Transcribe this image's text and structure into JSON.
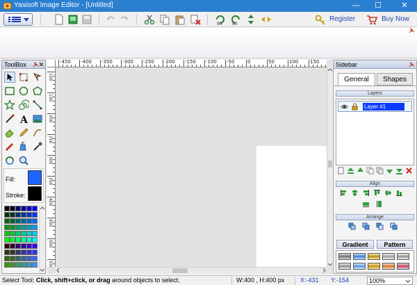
{
  "window": {
    "title": "Yasisoft Image Editor - [Untitled]",
    "minimize": "—",
    "maximize": "☐",
    "close": "✕"
  },
  "toolbar": {
    "register_label": "Register",
    "buy_label": "Buy Now",
    "rotate_left_label": "90",
    "rotate_right_label": "90"
  },
  "toolbox": {
    "title": "ToolBox",
    "fill_label": "Fill:",
    "stroke_label": "Stroke:",
    "fill_color": "#1a66ff",
    "stroke_color": "#000000",
    "palette": [
      [
        "#000000",
        "#000033",
        "#000066",
        "#000099",
        "#0000cc",
        "#0000ff"
      ],
      [
        "#003300",
        "#003333",
        "#003366",
        "#003399",
        "#0033cc",
        "#0033ff"
      ],
      [
        "#006600",
        "#006633",
        "#006666",
        "#006699",
        "#0066cc",
        "#0066ff"
      ],
      [
        "#009900",
        "#009933",
        "#009966",
        "#009999",
        "#0099cc",
        "#0099ff"
      ],
      [
        "#00cc00",
        "#00cc33",
        "#00cc66",
        "#00cc99",
        "#00cccc",
        "#00ccff"
      ],
      [
        "#00ff00",
        "#00ff33",
        "#00ff66",
        "#00ff99",
        "#00ffcc",
        "#00ffff"
      ],
      [
        "#330000",
        "#330033",
        "#330066",
        "#330099",
        "#3300cc",
        "#3300ff"
      ],
      [
        "#333300",
        "#333333",
        "#333366",
        "#333399",
        "#3333cc",
        "#3333ff"
      ],
      [
        "#336600",
        "#336633",
        "#336666",
        "#336699",
        "#3366cc",
        "#3366ff"
      ],
      [
        "#339900",
        "#339933",
        "#339966",
        "#339999",
        "#3399cc",
        "#3399ff"
      ]
    ]
  },
  "ruler": {
    "h_labels": [
      "-450",
      "-400",
      "-350",
      "-300",
      "-250",
      "-200",
      "-150",
      "-100",
      "-50",
      "0",
      "50",
      "100",
      "150"
    ],
    "v_labels": [
      "100",
      "150",
      "200",
      "250",
      "300",
      "350",
      "400",
      "450",
      "500",
      "550"
    ]
  },
  "sidebar": {
    "title": "Sidebar",
    "tabs": [
      "General",
      "Shapes"
    ],
    "layers_header": "Layers",
    "layer_name": "Layer #1",
    "align_header": "Align",
    "arrange_header": "Arrange",
    "bottom_tabs": [
      "Gradient",
      "Pattern"
    ]
  },
  "status": {
    "hint_prefix": "Select Tool: ",
    "hint_bold": "Click, shift+click, or drag",
    "hint_suffix": " around objects to select.",
    "size": "W:400 , H:400 px",
    "x": "X:-431",
    "y": "Y:-154",
    "zoom": "100%"
  },
  "colors": {
    "titlebar": "#2b7fd1",
    "accent_blue": "#1f3fb0",
    "layer_highlight": "#0a3cff"
  }
}
